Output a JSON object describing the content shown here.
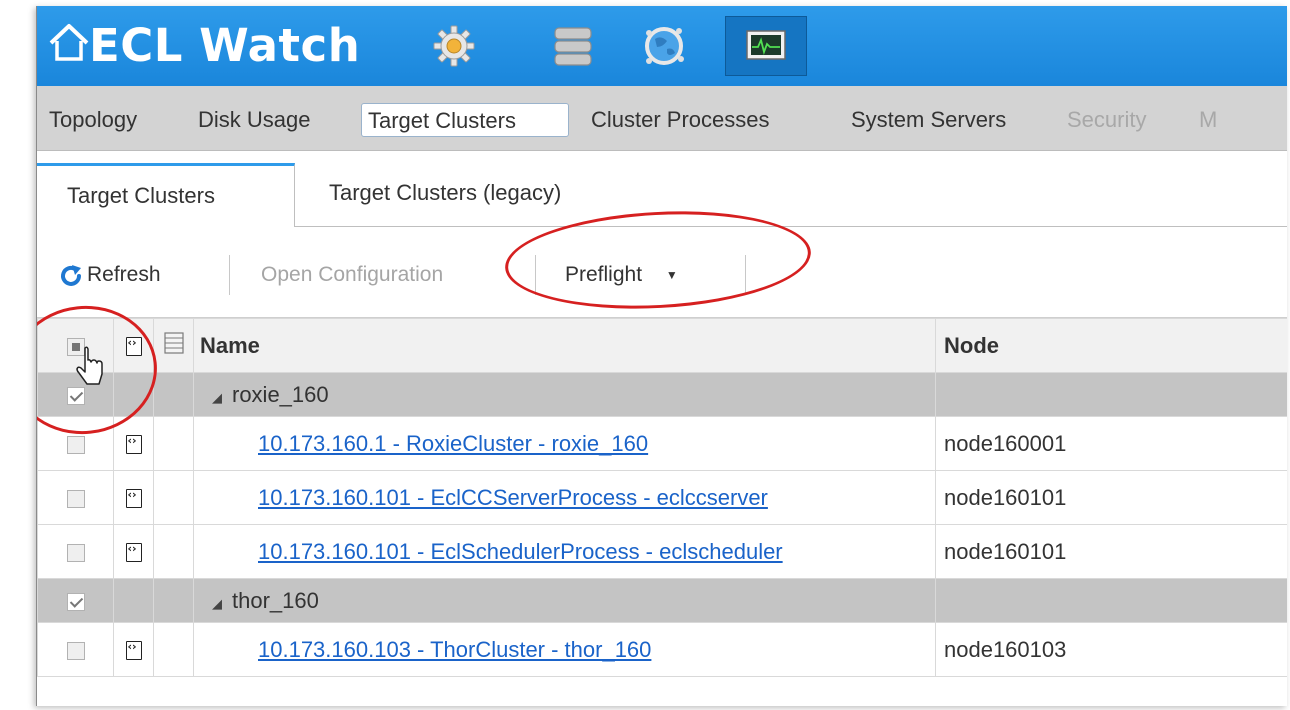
{
  "app": {
    "title": "ECL Watch",
    "icons": [
      "home-icon",
      "gear-icon",
      "database-icon",
      "globe-icon",
      "monitor-icon"
    ],
    "accent": "#1a86db"
  },
  "nav": {
    "items": [
      {
        "label": "Topology",
        "state": "normal"
      },
      {
        "label": "Disk Usage",
        "state": "normal"
      },
      {
        "label": "Target Clusters",
        "state": "active"
      },
      {
        "label": "Cluster Processes",
        "state": "normal"
      },
      {
        "label": "System Servers",
        "state": "normal"
      },
      {
        "label": "Security",
        "state": "disabled"
      },
      {
        "label": "M",
        "state": "disabled"
      }
    ]
  },
  "tabs": [
    {
      "label": "Target Clusters",
      "active": true
    },
    {
      "label": "Target Clusters (legacy)",
      "active": false
    }
  ],
  "toolbar": {
    "refresh_label": "Refresh",
    "open_config_label": "Open Configuration",
    "preflight_label": "Preflight"
  },
  "grid": {
    "columns": [
      "Name",
      "Node"
    ],
    "rows": [
      {
        "type": "group",
        "name": "roxie_160",
        "checked": true
      },
      {
        "type": "item",
        "name": "10.173.160.1 - RoxieCluster - roxie_160",
        "node": "node160001",
        "checked": false
      },
      {
        "type": "item",
        "name": "10.173.160.101 - EclCCServerProcess - eclccserver",
        "node": "node160101",
        "checked": false
      },
      {
        "type": "item",
        "name": "10.173.160.101 - EclSchedulerProcess - eclscheduler",
        "node": "node160101",
        "checked": false
      },
      {
        "type": "group",
        "name": "thor_160",
        "checked": true
      },
      {
        "type": "item",
        "name": "10.173.160.103 - ThorCluster - thor_160",
        "node": "node160103",
        "checked": false
      }
    ]
  },
  "annotation_color": "#d62020"
}
